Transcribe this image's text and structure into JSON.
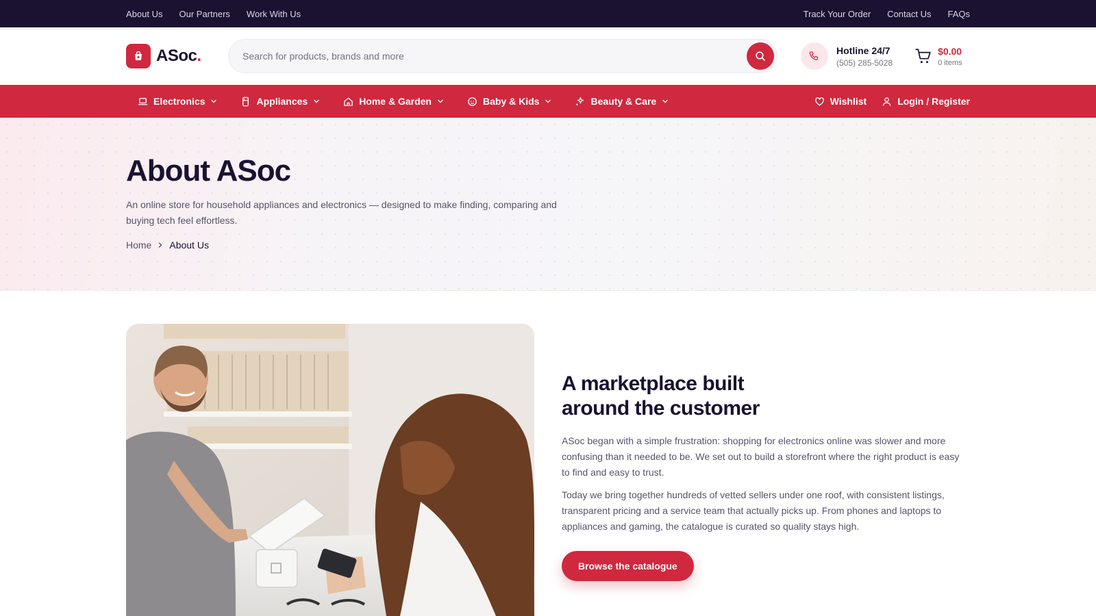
{
  "topbar": {
    "left_links": [
      "About Us",
      "Our Partners",
      "Work With Us"
    ],
    "right_links": [
      "Track Your Order",
      "Contact Us",
      "FAQs"
    ]
  },
  "header": {
    "logo_text": "ASoc",
    "logo_dot": ".",
    "search_placeholder": "Search for products, brands and more",
    "hotline_title": "Hotline 24/7",
    "hotline_number": "(505) 285-5028",
    "cart_total": "$0.00",
    "cart_items": "0 items"
  },
  "nav": {
    "categories": [
      {
        "label": "Electronics",
        "icon": "laptop-icon"
      },
      {
        "label": "Appliances",
        "icon": "appliance-icon"
      },
      {
        "label": "Home & Garden",
        "icon": "house-icon"
      },
      {
        "label": "Baby & Kids",
        "icon": "baby-icon"
      },
      {
        "label": "Beauty & Care",
        "icon": "sparkle-icon"
      }
    ],
    "wishlist": "Wishlist",
    "login": "Login / Register"
  },
  "hero": {
    "title": "About ASoc",
    "description": "An online store for household appliances and electronics — designed to make finding, comparing and buying tech feel effortless.",
    "breadcrumb_home": "Home",
    "breadcrumb_current": "About Us"
  },
  "story": {
    "heading_line1": "A marketplace built",
    "heading_line2": "around the customer",
    "paragraph1": "ASoc began with a simple frustration: shopping for electronics online was slower and more confusing than it needed to be. We set out to build a storefront where the right product is easy to find and easy to trust.",
    "paragraph2": "Today we bring together hundreds of vetted sellers under one roof, with consistent listings, transparent pricing and a service team that actually picks up. From phones and laptops to appliances and gaming, the catalogue is curated so quality stays high.",
    "cta": "Browse the catalogue"
  },
  "colors": {
    "brand": "#d0283f",
    "topbar": "#1a1230"
  }
}
